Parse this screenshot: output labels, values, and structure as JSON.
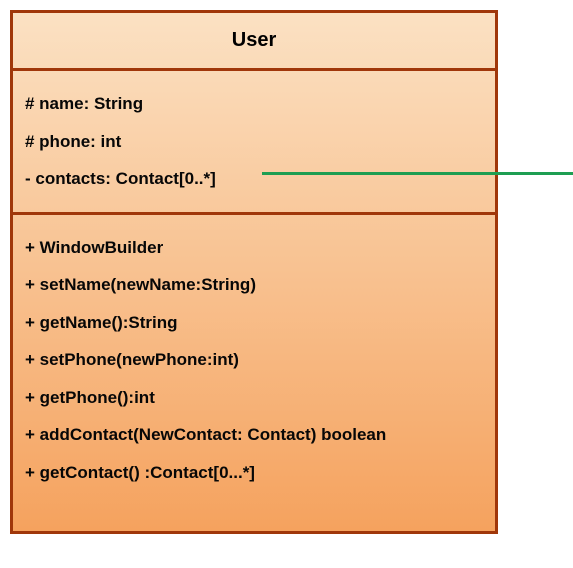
{
  "class": {
    "name": "User",
    "attributes": [
      "# name: String",
      "# phone: int",
      "- contacts: Contact[0..*]"
    ],
    "methods": [
      "+ WindowBuilder",
      "+ setName(newName:String)",
      "+ getName():String",
      "+ setPhone(newPhone:int)",
      "+ getPhone():int",
      "+ addContact(NewContact: Contact) boolean",
      "+ getContact() :Contact[0...*]"
    ]
  }
}
